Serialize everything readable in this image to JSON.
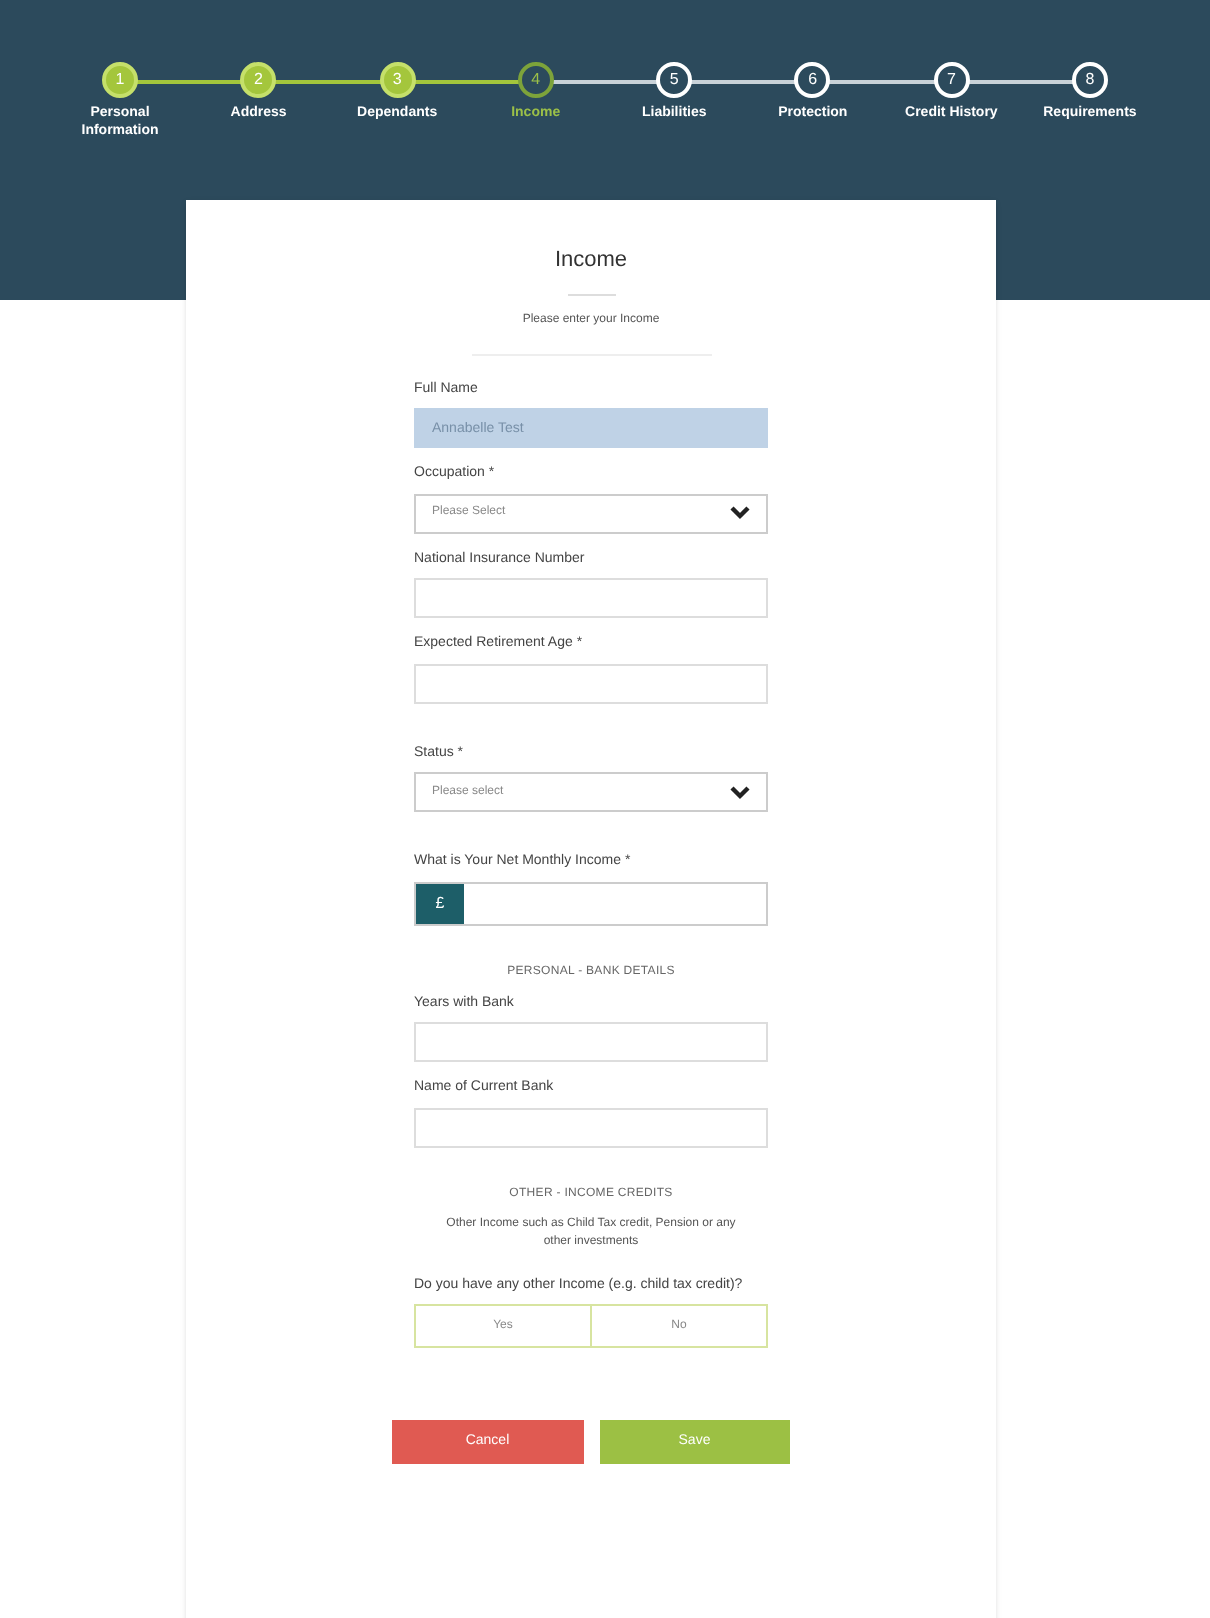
{
  "steps": [
    {
      "number": "1",
      "label": "Personal Information",
      "completed": true,
      "selected": false
    },
    {
      "number": "2",
      "label": "Address",
      "completed": true,
      "selected": false
    },
    {
      "number": "3",
      "label": "Dependants",
      "completed": true,
      "selected": false
    },
    {
      "number": "4",
      "label": "Income",
      "completed": false,
      "selected": true
    },
    {
      "number": "5",
      "label": "Liabilities",
      "completed": false,
      "selected": false
    },
    {
      "number": "6",
      "label": "Protection",
      "completed": false,
      "selected": false
    },
    {
      "number": "7",
      "label": "Credit History",
      "completed": false,
      "selected": false
    },
    {
      "number": "8",
      "label": "Requirements",
      "completed": false,
      "selected": false
    }
  ],
  "form": {
    "title": "Income",
    "subtitle": "Please enter your Income",
    "groups": [
      [
        {
          "kind": "text",
          "label": "Full Name",
          "value": "Annabelle Test",
          "disabled": true
        },
        {
          "kind": "select",
          "label": "Occupation *",
          "placeholder": "Please Select"
        },
        {
          "kind": "text",
          "label": "National Insurance Number"
        },
        {
          "kind": "text",
          "label": "Expected Retirement Age *"
        }
      ],
      [
        {
          "kind": "select",
          "label": "Status *",
          "placeholder": "Please select"
        }
      ],
      [
        {
          "kind": "money",
          "label": "What is Your Net Monthly Income *",
          "prefix": "£"
        }
      ],
      [
        {
          "kind": "heading",
          "label": "PERSONAL - BANK DETAILS"
        },
        {
          "kind": "text",
          "label": "Years with Bank"
        },
        {
          "kind": "text",
          "label": "Name of Current Bank"
        }
      ],
      [
        {
          "kind": "heading",
          "label": "OTHER - INCOME CREDITS"
        },
        {
          "kind": "note",
          "label": "Other Income such as Child Tax credit, Pension or any other investments"
        },
        {
          "kind": "toggle",
          "label": "Do you have any other Income (e.g. child tax credit)?",
          "options": [
            {
              "label": "Yes",
              "selected": false
            },
            {
              "label": "No",
              "selected": false
            }
          ]
        }
      ]
    ],
    "buttons": [
      {
        "label": "Cancel",
        "kind": "cancel"
      },
      {
        "label": "Save",
        "kind": "save"
      }
    ]
  }
}
